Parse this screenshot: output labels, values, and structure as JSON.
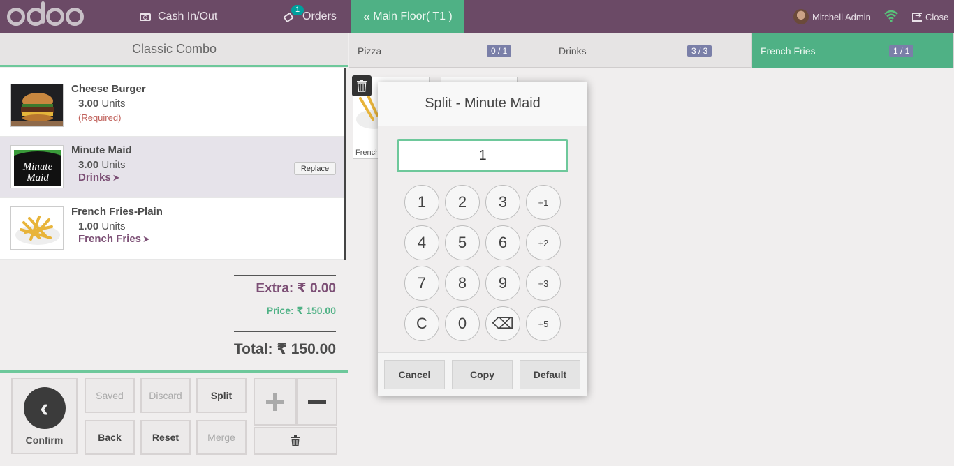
{
  "topbar": {
    "logo": "odoo",
    "cash_label": "Cash In/Out",
    "orders_label": "Orders",
    "orders_badge": "1",
    "floor_label": "Main Floor( T1 )",
    "user_name": "Mitchell Admin",
    "close_label": "Close"
  },
  "combo": {
    "title": "Classic Combo",
    "lines": [
      {
        "name": "Cheese Burger",
        "qty": "3.00",
        "unit": "Units",
        "note": "(Required)"
      },
      {
        "name": "Minute Maid",
        "qty": "3.00",
        "unit": "Units",
        "category": "Drinks",
        "replace_label": "Replace"
      },
      {
        "name": "French Fries-Plain",
        "qty": "1.00",
        "unit": "Units",
        "category": "French Fries"
      }
    ],
    "extra": "Extra: ₹ 0.00",
    "price": "Price: ₹ 150.00",
    "total": "Total: ₹ 150.00"
  },
  "controls": {
    "confirm": "Confirm",
    "saved": "Saved",
    "discard": "Discard",
    "split": "Split",
    "back": "Back",
    "reset": "Reset",
    "merge": "Merge"
  },
  "tabs": [
    {
      "label": "Pizza",
      "count": "0 / 1"
    },
    {
      "label": "Drinks",
      "count": "3 / 3"
    },
    {
      "label": "French Fries",
      "count": "1 / 1"
    }
  ],
  "products": {
    "card_label": "French"
  },
  "modal": {
    "title": "Split - Minute Maid",
    "value": "1",
    "keys": [
      "1",
      "2",
      "3",
      "+1",
      "4",
      "5",
      "6",
      "+2",
      "7",
      "8",
      "9",
      "+3",
      "C",
      "0",
      "⌫",
      "+5"
    ],
    "cancel": "Cancel",
    "copy": "Copy",
    "default": "Default"
  },
  "colors": {
    "topbar": "#6b4a66",
    "accent_green": "#4fb185",
    "accent_purple": "#7c4f75"
  }
}
